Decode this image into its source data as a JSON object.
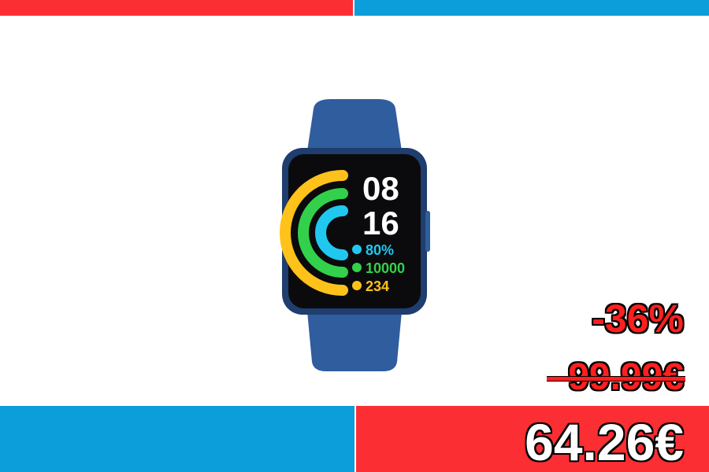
{
  "promo": {
    "discount": "-36%",
    "old_price": "99.99€",
    "new_price": "64.26€"
  },
  "watch": {
    "hour": "08",
    "minute": "16",
    "battery": "80%",
    "steps": "10000",
    "calories": "234"
  },
  "colors": {
    "red": "#fb2e33",
    "blue": "#0c9ddb",
    "strap": "#2f5d9e",
    "ring_yellow": "#ffc21a",
    "ring_green": "#33d04c",
    "ring_cyan": "#20c8f0"
  }
}
